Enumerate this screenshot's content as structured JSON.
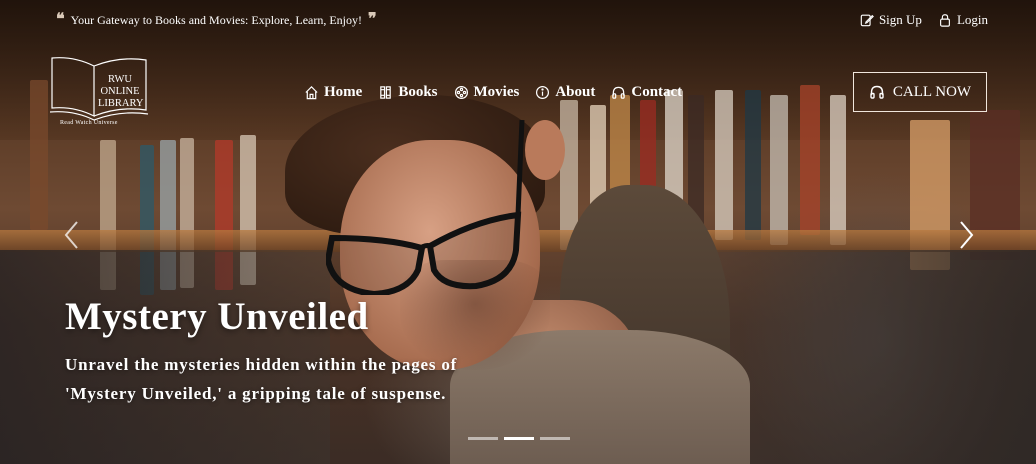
{
  "topbar": {
    "tagline": "Your Gateway to Books and Movies: Explore, Learn, Enjoy!",
    "open_quote_icon": "quote-left-icon",
    "close_quote_icon": "quote-right-icon",
    "signup_label": "Sign Up",
    "login_label": "Login"
  },
  "logo": {
    "line1": "RWU",
    "line2": "ONLINE",
    "line3": "LIBRARY",
    "subtitle": "Read Watch Universe"
  },
  "nav": {
    "items": [
      {
        "label": "Home",
        "icon": "home-icon"
      },
      {
        "label": "Books",
        "icon": "book-icon"
      },
      {
        "label": "Movies",
        "icon": "film-reel-icon"
      },
      {
        "label": "About",
        "icon": "info-icon"
      },
      {
        "label": "Contact",
        "icon": "headphones-icon"
      }
    ],
    "cta_label": "CALL NOW"
  },
  "carousel": {
    "title": "Mystery Unveiled",
    "text": "Unravel the mysteries hidden within the pages of 'Mystery Unveiled,' a gripping tale of suspense.",
    "active_slide": 2,
    "slide_count": 3
  },
  "colors": {
    "text": "#ffffff",
    "accent_border": "#f0e6dc"
  }
}
